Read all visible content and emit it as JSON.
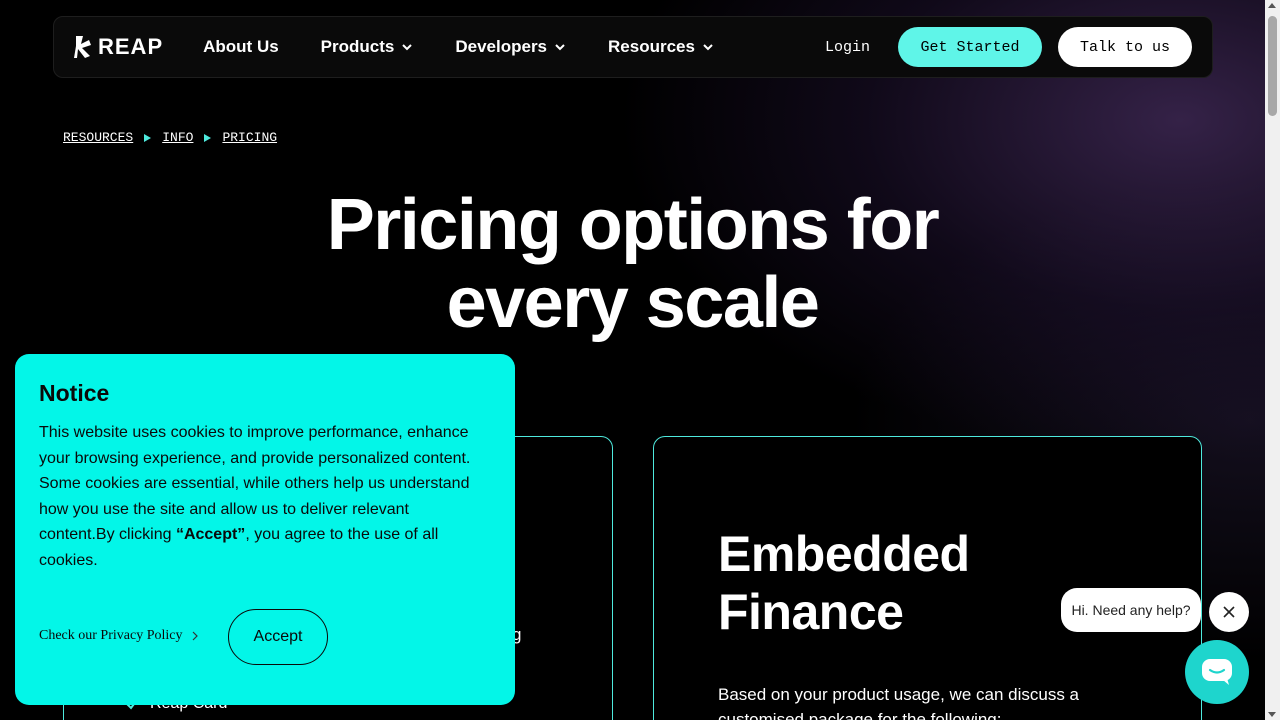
{
  "nav": {
    "logo_text": "REAP",
    "links": [
      {
        "label": "About Us"
      },
      {
        "label": "Products"
      },
      {
        "label": "Developers"
      },
      {
        "label": "Resources"
      }
    ],
    "login": "Login",
    "get_started": "Get Started",
    "talk": "Talk to us"
  },
  "breadcrumb": [
    "RESOURCES",
    "INFO",
    "PRICING"
  ],
  "hero": {
    "line1": "Pricing options for",
    "line2": "every scale"
  },
  "cards": {
    "left": {
      "peek_text": "g",
      "feature": "Reap Card"
    },
    "right": {
      "title_line1": "Embedded",
      "title_line2": "Finance",
      "desc": "Based on your product usage, we can discuss a customised package for the following:"
    }
  },
  "notice": {
    "title": "Notice",
    "body_before": "This website uses cookies to improve performance, enhance your browsing experience, and provide personalized content. Some cookies are essential, while others help us understand how you use the site and allow us to deliver relevant content.By clicking ",
    "body_bold": "“Accept”",
    "body_after": ", you agree to the use of all cookies.",
    "privacy": "Check our Privacy Policy",
    "accept": "Accept"
  },
  "chat": {
    "bubble": "Hi. Need any help?"
  },
  "colors": {
    "accent": "#5ff5e8",
    "notice_bg": "#03f6e8",
    "card_border": "#4ee9dd",
    "chat_launcher": "#1ed5cd"
  }
}
